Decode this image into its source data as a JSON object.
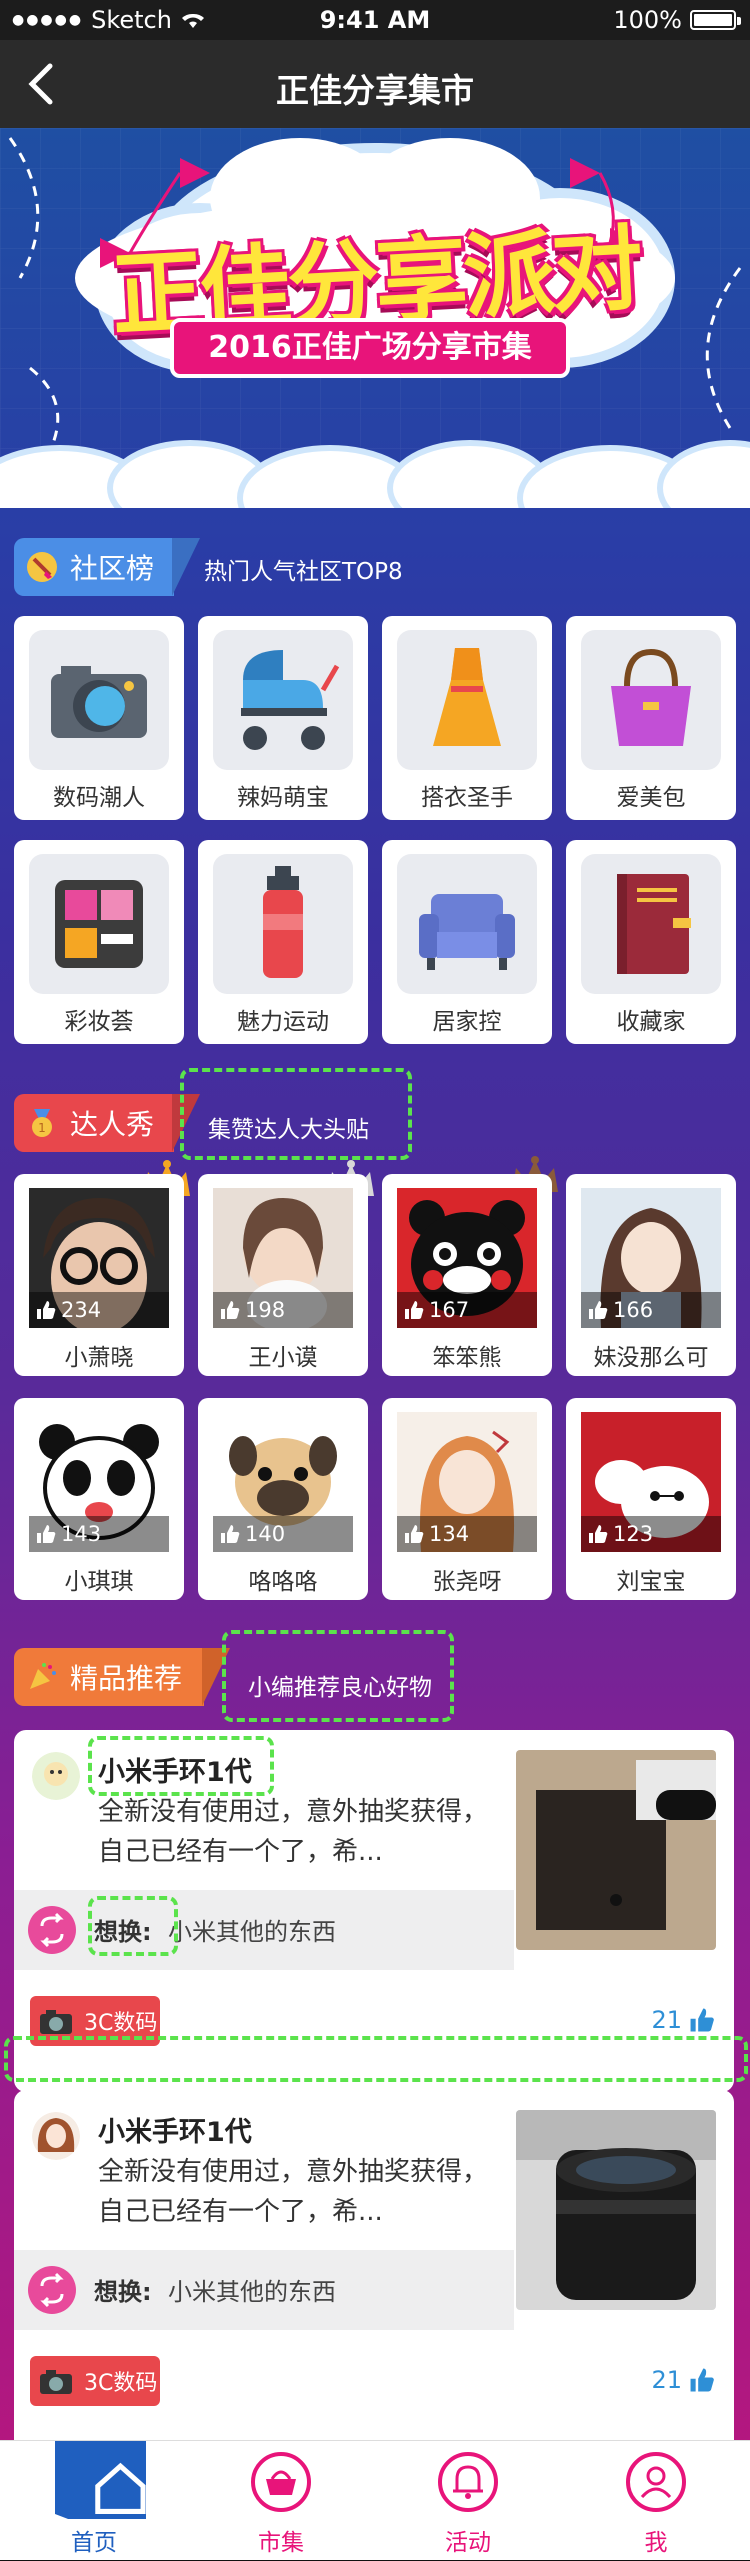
{
  "status_bar": {
    "carrier": "Sketch",
    "time": "9:41 AM",
    "battery": "100%"
  },
  "nav": {
    "title": "正佳分享集市"
  },
  "banner": {
    "headline": "正佳分享派对",
    "ribbon": "2016正佳广场分享市集"
  },
  "community": {
    "tag": "社区榜",
    "subtitle": "热门人气社区TOP8",
    "categories": [
      {
        "label": "数码潮人",
        "icon": "camera-icon"
      },
      {
        "label": "辣妈萌宝",
        "icon": "stroller-icon"
      },
      {
        "label": "搭衣圣手",
        "icon": "dress-icon"
      },
      {
        "label": "爱美包",
        "icon": "handbag-icon"
      },
      {
        "label": "彩妆荟",
        "icon": "makeup-palette-icon"
      },
      {
        "label": "魅力运动",
        "icon": "water-bottle-icon"
      },
      {
        "label": "居家控",
        "icon": "sofa-icon"
      },
      {
        "label": "收藏家",
        "icon": "book-icon"
      }
    ]
  },
  "talent": {
    "tag": "达人秀",
    "subtitle": "集赞达人大头贴",
    "people": [
      {
        "name": "小萧晓",
        "likes": "234",
        "icon": "girl-glasses-photo"
      },
      {
        "name": "王小谟",
        "likes": "198",
        "icon": "girl-cat-photo"
      },
      {
        "name": "笨笨熊",
        "likes": "167",
        "icon": "kumamon-photo"
      },
      {
        "name": "妹没那么可",
        "likes": "166",
        "icon": "anime-girl-photo"
      },
      {
        "name": "小琪琪",
        "likes": "143",
        "icon": "panda-cartoon-photo"
      },
      {
        "name": "咯咯咯",
        "likes": "140",
        "icon": "pug-photo"
      },
      {
        "name": "张尧呀",
        "likes": "134",
        "icon": "anime-girl-2-photo"
      },
      {
        "name": "刘宝宝",
        "likes": "123",
        "icon": "baymax-photo"
      }
    ]
  },
  "picks": {
    "tag": "精品推荐",
    "subtitle": "小编推荐良心好物",
    "posts": [
      {
        "title": "小米手环1代",
        "desc": "全新没有使用过，意外抽奖获得，自己已经有一个了，希...",
        "swap_label": "想换:",
        "swap_text": "小米其他的东西",
        "tag": "3C数码",
        "likes": "21"
      },
      {
        "title": "小米手环1代",
        "desc": "全新没有使用过，意外抽奖获得，自己已经有一个了，希...",
        "swap_label": "想换:",
        "swap_text": "小米其他的东西",
        "tag": "3C数码",
        "likes": "21"
      }
    ]
  },
  "tabbar": {
    "tabs": [
      {
        "label": "首页",
        "icon": "home-icon"
      },
      {
        "label": "市集",
        "icon": "basket-icon"
      },
      {
        "label": "活动",
        "icon": "bell-icon"
      },
      {
        "label": "我",
        "icon": "user-icon"
      }
    ]
  },
  "colors": {
    "accent": "#e8147a",
    "highlight": "#5be34c",
    "link": "#2e8fd6"
  }
}
